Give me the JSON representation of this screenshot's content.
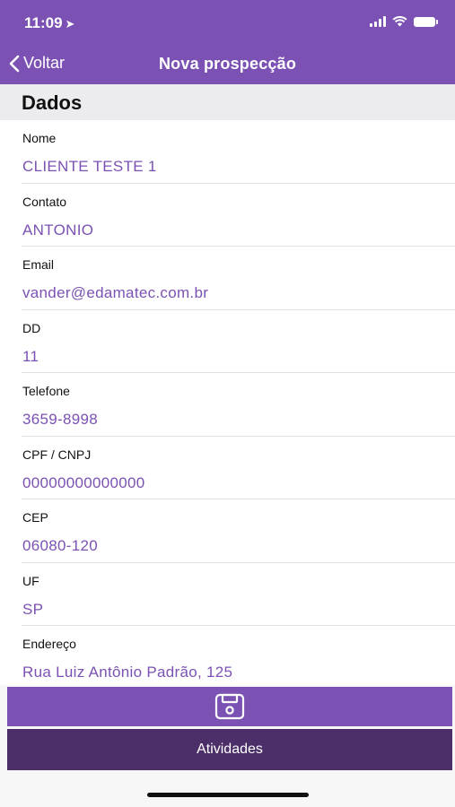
{
  "status_bar": {
    "time": "11:09",
    "location_icon": "location-arrow-icon"
  },
  "nav": {
    "back_label": "Voltar",
    "title": "Nova prospecção"
  },
  "section": {
    "title": "Dados"
  },
  "fields": [
    {
      "label": "Nome",
      "value": "CLIENTE TESTE 1"
    },
    {
      "label": "Contato",
      "value": "ANTONIO"
    },
    {
      "label": "Email",
      "value": "vander@edamatec.com.br"
    },
    {
      "label": "DD",
      "value": "11"
    },
    {
      "label": "Telefone",
      "value": "3659-8998"
    },
    {
      "label": "CPF / CNPJ",
      "value": "00000000000000"
    },
    {
      "label": "CEP",
      "value": "06080-120"
    },
    {
      "label": "UF",
      "value": "SP"
    },
    {
      "label": "Endereço",
      "value": "Rua Luiz Antônio Padrão, 125"
    }
  ],
  "buttons": {
    "save_icon": "save-icon",
    "activities_label": "Atividades"
  },
  "colors": {
    "accent": "#7b52b3",
    "dark_accent": "#4c2f68",
    "header_bg": "#ececef"
  }
}
